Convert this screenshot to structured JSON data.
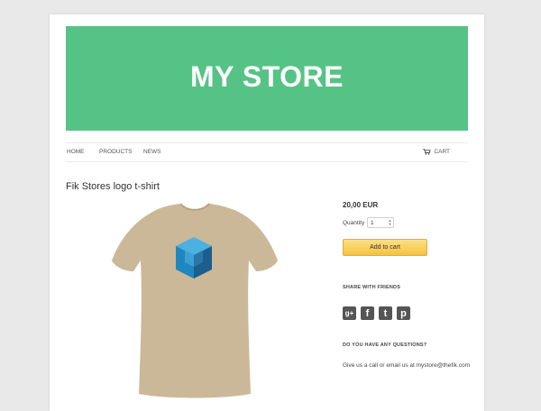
{
  "header": {
    "store_title": "MY STORE"
  },
  "nav": {
    "items": [
      {
        "label": "HOME"
      },
      {
        "label": "PRODUCTS"
      },
      {
        "label": "NEWS"
      }
    ],
    "cart_label": "CART"
  },
  "product": {
    "title": "Fik Stores logo t-shirt",
    "price": "20,00 EUR",
    "quantity_label": "Quantity",
    "quantity_value": "1",
    "add_to_cart_label": "Add to cart",
    "shirt_color": "#cbb899",
    "logo_colors": [
      "#1e87c0",
      "#4bb1e0",
      "#1a5f8d"
    ]
  },
  "share": {
    "heading": "SHARE WITH FRIENDS",
    "icons": [
      {
        "name": "google-plus-icon",
        "glyph": "g+"
      },
      {
        "name": "facebook-icon",
        "glyph": "f"
      },
      {
        "name": "twitter-icon",
        "glyph": "t"
      },
      {
        "name": "pinterest-icon",
        "glyph": "p"
      }
    ]
  },
  "questions": {
    "heading": "DO YOU HAVE ANY QUESTIONS?",
    "text": "Give us a call or email us at mystore@thefik.com"
  },
  "colors": {
    "banner": "#56c386",
    "button": "#f5c23e",
    "background": "#e9e9e9"
  }
}
